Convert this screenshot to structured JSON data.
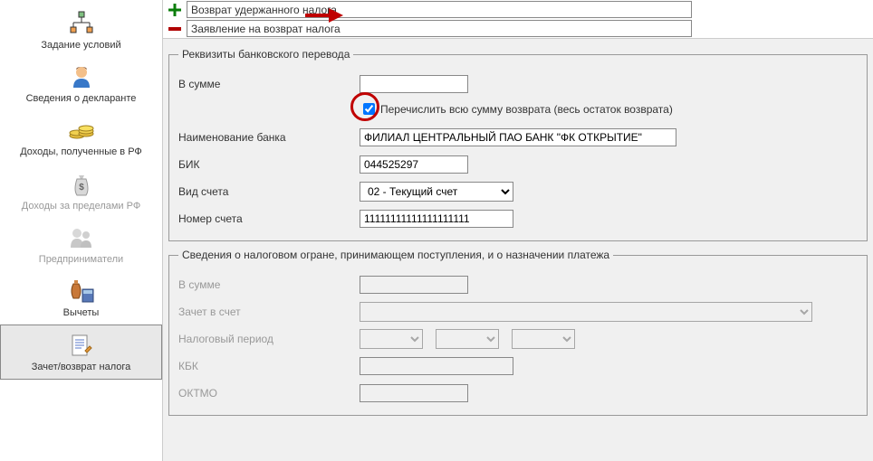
{
  "sidebar": {
    "items": [
      {
        "label": "Задание условий"
      },
      {
        "label": "Сведения о декларанте"
      },
      {
        "label": "Доходы, полученные в РФ"
      },
      {
        "label": "Доходы за пределами РФ"
      },
      {
        "label": "Предприниматели"
      },
      {
        "label": "Вычеты"
      },
      {
        "label": "Зачет/возврат налога"
      }
    ]
  },
  "topRows": {
    "row1": "Возврат удержанного налога",
    "row2": "Заявление на возврат налога"
  },
  "group1": {
    "legend": "Реквизиты банковского перевода",
    "amountLabel": "В сумме",
    "amountValue": "",
    "transferAllLabel": "Перечислить всю сумму возврата (весь остаток возврата)",
    "bankNameLabel": "Наименование банка",
    "bankNameValue": "ФИЛИАЛ ЦЕНТРАЛЬНЫЙ ПАО БАНК \"ФК ОТКРЫТИЕ\"",
    "bikLabel": "БИК",
    "bikValue": "044525297",
    "accTypeLabel": "Вид счета",
    "accTypeValue": "02 - Текущий счет",
    "accNumLabel": "Номер счета",
    "accNumValue": "11111111111111111111"
  },
  "group2": {
    "legend": "Сведения о налоговом огране, принимающем поступления, и о назначении платежа",
    "amountLabel": "В сумме",
    "creditLabel": "Зачет в счет",
    "periodLabel": "Налоговый период",
    "kbkLabel": "КБК",
    "oktmoLabel": "ОКТМО"
  }
}
